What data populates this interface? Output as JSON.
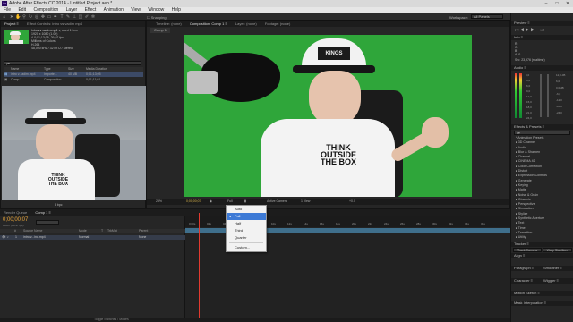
{
  "window": {
    "title": "Adobe After Effects CC 2014 - Untitled Project.aep *",
    "controls": [
      "–",
      "□",
      "✕"
    ]
  },
  "menu": [
    "File",
    "Edit",
    "Composition",
    "Layer",
    "Effect",
    "Animation",
    "View",
    "Window",
    "Help"
  ],
  "toolbar": {
    "snapping": "Snapping",
    "workspace_label": "Workspace:",
    "workspace_value": "All Panels",
    "search_placeholder": "Search Help"
  },
  "project": {
    "tab": "Project ≡",
    "tab2": "Effect Controls: intro vs vadim mp4",
    "file_name": "intro vs vadim.mp4 ▾",
    "file_used": ", used 1 time",
    "file_meta": [
      "1920 x 1080 (1.00)",
      "Δ 0;01;13;05, 29,97 fps",
      "Millions of Colors",
      "H.264",
      "48,000 kHz / 32 bit U / Stereo"
    ],
    "search_placeholder": "ρ▾",
    "columns": [
      "Name",
      "Type",
      "Size",
      "Media Duration"
    ],
    "rows": [
      {
        "name": "intro v...adim.mp4",
        "type": "Importe...",
        "size": "40 MB",
        "duration": "0;01;13;05"
      },
      {
        "name": "Comp 1",
        "type": "Composition",
        "size": "",
        "duration": "0;01;11;01"
      }
    ],
    "bpc": "8 bpc"
  },
  "viewer": {
    "tabs": [
      "Timeline: (none)",
      "Composition: Comp 1 ≡",
      "Layer: (none)",
      "Footage: (none)"
    ],
    "comp_tab": "Comp 1",
    "bottom": {
      "zoom": "25%",
      "timecode": "0;00;00;07",
      "resolution": "Full",
      "camera": "Active Camera",
      "view": "1 View",
      "extra": "+0.0"
    }
  },
  "resolution_menu": {
    "items": [
      "Auto",
      "Full",
      "Half",
      "Third",
      "Quarter",
      "Custom..."
    ],
    "checked": "Full",
    "highlighted": "Full"
  },
  "timeline": {
    "tab": "Render Queue",
    "comp_tab": "Comp 1 ≡",
    "timecode": "0;00;00;07",
    "timecode_sub": "00007 (29.97 fps)",
    "columns": [
      "#",
      "Source Name",
      "Mode",
      "T",
      "TrkMat",
      "Parent"
    ],
    "layers": [
      {
        "index": "1",
        "name": "intro v...ino.mp4",
        "mode": "Normal",
        "parent": "None"
      }
    ],
    "ruler_marks": [
      "0:00s",
      "02s",
      "04s",
      "06s",
      "08s",
      "10s",
      "12s",
      "14s",
      "16s",
      "18s",
      "20s",
      "22s",
      "24s",
      "26s",
      "28s",
      "30s",
      "32s",
      "34s",
      "36s"
    ],
    "footer": "Toggle Switches / Modes"
  },
  "right_panels": {
    "preview": "Preview ≡",
    "info": "Info ≡",
    "info_lines": [
      "R:",
      "G:",
      "B:",
      "A: 0"
    ],
    "info_extra": "Src: 23,976 (realtime)",
    "audio": "Audio ≡",
    "audio_db": [
      "0,0",
      "-3,0",
      "-6,0",
      "-9,0",
      "-12,0",
      "-15,0",
      "-18,0",
      "-21,0",
      "-24,0"
    ],
    "audio_db_right": [
      "12,0 dB",
      "6,0",
      "0,0 dB",
      "-6,0",
      "-12,0",
      "-18,0",
      "-24,0"
    ],
    "effects_head": "Effects & Presets ≡",
    "effects_search": "ρ▾",
    "effects": [
      "* Animation Presets",
      "▸ 3D Channel",
      "▸ Audio",
      "▸ Blur & Sharpen",
      "▸ Channel",
      "▸ CINEMA 4D",
      "▸ Color Correction",
      "▸ Distort",
      "▸ Expression Controls",
      "▸ Generate",
      "▸ Keying",
      "▸ Matte",
      "▸ Noise & Grain",
      "▸ Obsolete",
      "▸ Perspective",
      "▸ Simulation",
      "▸ Stylize",
      "▸ Synthetic Aperture",
      "▸ Text",
      "▸ Time",
      "▸ Transition",
      "▸ Utility"
    ],
    "tracker": "Tracker ≡",
    "tracker_btns": [
      "Track Camera",
      "Warp Stabilizer"
    ],
    "align": "Align ≡",
    "paragraph": "Paragraph ≡",
    "smoother": "Smoother ≡",
    "character": "Character ≡",
    "wiggler": "Wiggler ≡",
    "motion": "Motion Sketch ≡",
    "mask": "Mask Interpolation ≡",
    "paint": "Paint ≡",
    "brushes": "Brushes ≡"
  }
}
